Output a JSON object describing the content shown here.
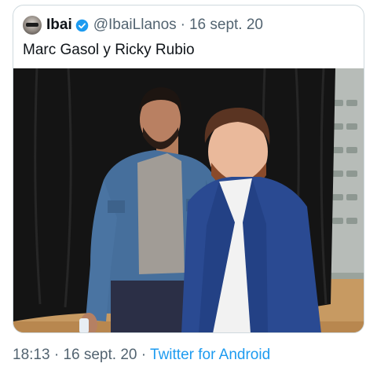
{
  "tweet": {
    "author": {
      "display_name": "Ibai",
      "handle": "@IbaiLlanos",
      "verified": true,
      "avatar_icon": "avatar-photo"
    },
    "separator": "·",
    "date": "16 sept. 20",
    "text": "Marc Gasol y Ricky Rubio",
    "media": {
      "type": "photo",
      "icon": "photo-two-men-posing"
    }
  },
  "footer": {
    "time": "18:13",
    "separator": "·",
    "date": "16 sept. 20",
    "source": "Twitter for Android"
  },
  "colors": {
    "text_primary": "#0f1419",
    "text_secondary": "#536471",
    "link": "#1d9bf0",
    "verified_badge": "#1d9bf0",
    "border": "#cfd9de"
  }
}
